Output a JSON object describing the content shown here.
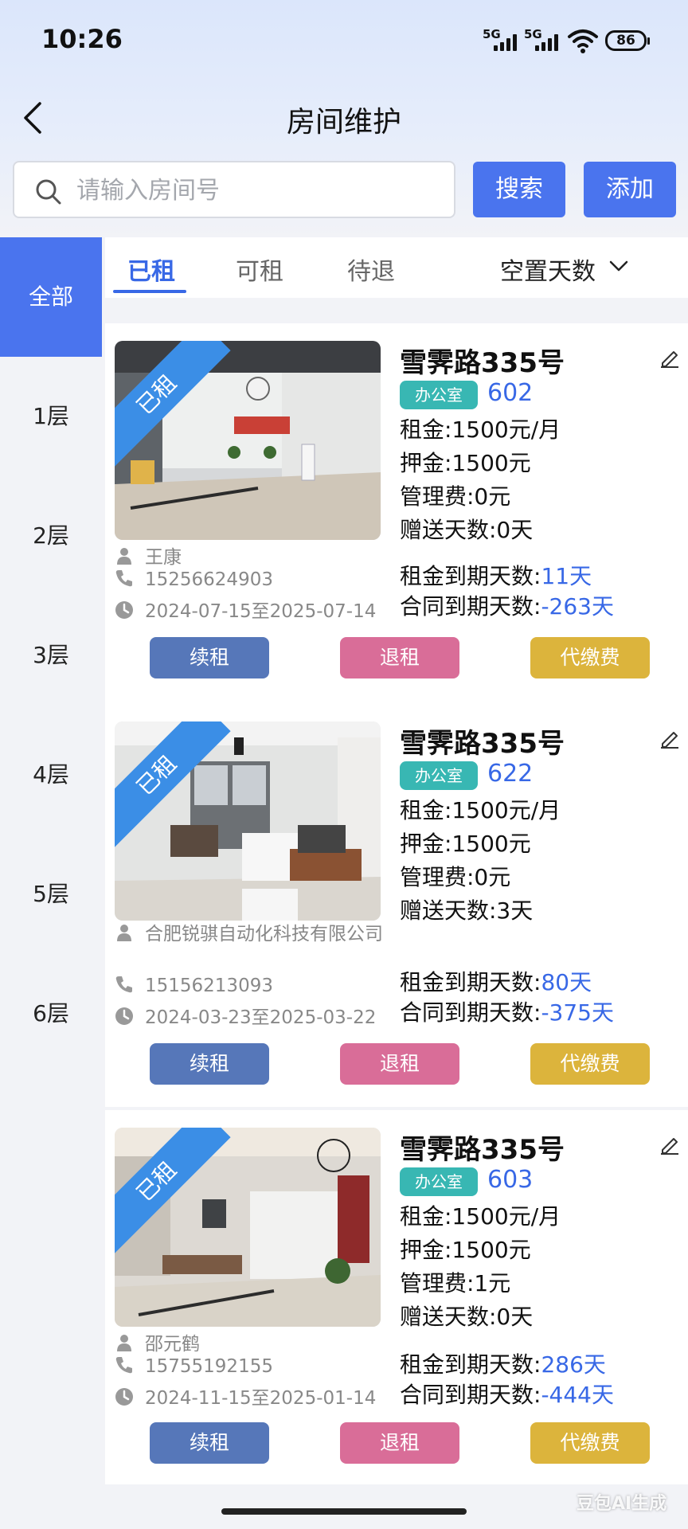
{
  "status_bar": {
    "time": "10:26",
    "signal1": "5G",
    "signal2": "5G",
    "battery": "86"
  },
  "header": {
    "title": "房间维护"
  },
  "search": {
    "placeholder": "请输入房间号",
    "search_label": "搜索",
    "add_label": "添加"
  },
  "sidebar": {
    "items": [
      "全部",
      "1层",
      "2层",
      "3层",
      "4层",
      "5层",
      "6层"
    ],
    "active": "全部"
  },
  "tabs": {
    "items": [
      "已租",
      "可租",
      "待退"
    ],
    "active": "已租",
    "sort_label": "空置天数"
  },
  "rooms": [
    {
      "status": "已租",
      "address": "雪霁路335号",
      "type": "办公室",
      "room_no": "602",
      "rent": "租金:1500元/月",
      "deposit": "押金:1500元",
      "mgmt_fee": "管理费:0元",
      "free_days": "赠送天数:0天",
      "tenant": "王康",
      "phone": "15256624903",
      "period": "2024-07-15至2025-07-14",
      "rent_due_label": "租金到期天数:",
      "rent_due_value": "11天",
      "contract_due_label": "合同到期天数:",
      "contract_due_value": "-263天"
    },
    {
      "status": "已租",
      "address": "雪霁路335号",
      "type": "办公室",
      "room_no": "622",
      "rent": "租金:1500元/月",
      "deposit": "押金:1500元",
      "mgmt_fee": "管理费:0元",
      "free_days": "赠送天数:3天",
      "tenant": "合肥锐骐自动化科技有限公司",
      "phone": "15156213093",
      "period": "2024-03-23至2025-03-22",
      "rent_due_label": "租金到期天数:",
      "rent_due_value": "80天",
      "contract_due_label": "合同到期天数:",
      "contract_due_value": "-375天"
    },
    {
      "status": "已租",
      "address": "雪霁路335号",
      "type": "办公室",
      "room_no": "603",
      "rent": "租金:1500元/月",
      "deposit": "押金:1500元",
      "mgmt_fee": "管理费:1元",
      "free_days": "赠送天数:0天",
      "tenant": "邵元鹤",
      "phone": "15755192155",
      "period": "2024-11-15至2025-01-14",
      "rent_due_label": "租金到期天数:",
      "rent_due_value": "286天",
      "contract_due_label": "合同到期天数:",
      "contract_due_value": "-444天"
    }
  ],
  "actions": {
    "renew": "续租",
    "unrent": "退租",
    "fee": "代缴费"
  },
  "watermark": "豆包AI生成"
}
